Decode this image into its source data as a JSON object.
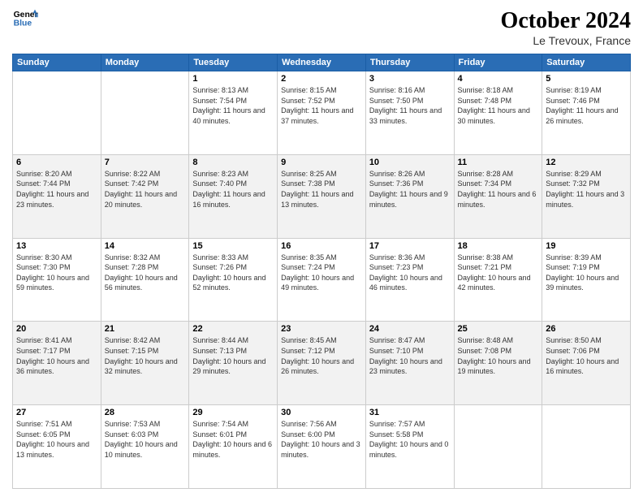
{
  "header": {
    "logo_line1": "General",
    "logo_line2": "Blue",
    "title": "October 2024",
    "subtitle": "Le Trevoux, France"
  },
  "columns": [
    "Sunday",
    "Monday",
    "Tuesday",
    "Wednesday",
    "Thursday",
    "Friday",
    "Saturday"
  ],
  "weeks": [
    [
      {
        "day": "",
        "sunrise": "",
        "sunset": "",
        "daylight": ""
      },
      {
        "day": "",
        "sunrise": "",
        "sunset": "",
        "daylight": ""
      },
      {
        "day": "1",
        "sunrise": "Sunrise: 8:13 AM",
        "sunset": "Sunset: 7:54 PM",
        "daylight": "Daylight: 11 hours and 40 minutes."
      },
      {
        "day": "2",
        "sunrise": "Sunrise: 8:15 AM",
        "sunset": "Sunset: 7:52 PM",
        "daylight": "Daylight: 11 hours and 37 minutes."
      },
      {
        "day": "3",
        "sunrise": "Sunrise: 8:16 AM",
        "sunset": "Sunset: 7:50 PM",
        "daylight": "Daylight: 11 hours and 33 minutes."
      },
      {
        "day": "4",
        "sunrise": "Sunrise: 8:18 AM",
        "sunset": "Sunset: 7:48 PM",
        "daylight": "Daylight: 11 hours and 30 minutes."
      },
      {
        "day": "5",
        "sunrise": "Sunrise: 8:19 AM",
        "sunset": "Sunset: 7:46 PM",
        "daylight": "Daylight: 11 hours and 26 minutes."
      }
    ],
    [
      {
        "day": "6",
        "sunrise": "Sunrise: 8:20 AM",
        "sunset": "Sunset: 7:44 PM",
        "daylight": "Daylight: 11 hours and 23 minutes."
      },
      {
        "day": "7",
        "sunrise": "Sunrise: 8:22 AM",
        "sunset": "Sunset: 7:42 PM",
        "daylight": "Daylight: 11 hours and 20 minutes."
      },
      {
        "day": "8",
        "sunrise": "Sunrise: 8:23 AM",
        "sunset": "Sunset: 7:40 PM",
        "daylight": "Daylight: 11 hours and 16 minutes."
      },
      {
        "day": "9",
        "sunrise": "Sunrise: 8:25 AM",
        "sunset": "Sunset: 7:38 PM",
        "daylight": "Daylight: 11 hours and 13 minutes."
      },
      {
        "day": "10",
        "sunrise": "Sunrise: 8:26 AM",
        "sunset": "Sunset: 7:36 PM",
        "daylight": "Daylight: 11 hours and 9 minutes."
      },
      {
        "day": "11",
        "sunrise": "Sunrise: 8:28 AM",
        "sunset": "Sunset: 7:34 PM",
        "daylight": "Daylight: 11 hours and 6 minutes."
      },
      {
        "day": "12",
        "sunrise": "Sunrise: 8:29 AM",
        "sunset": "Sunset: 7:32 PM",
        "daylight": "Daylight: 11 hours and 3 minutes."
      }
    ],
    [
      {
        "day": "13",
        "sunrise": "Sunrise: 8:30 AM",
        "sunset": "Sunset: 7:30 PM",
        "daylight": "Daylight: 10 hours and 59 minutes."
      },
      {
        "day": "14",
        "sunrise": "Sunrise: 8:32 AM",
        "sunset": "Sunset: 7:28 PM",
        "daylight": "Daylight: 10 hours and 56 minutes."
      },
      {
        "day": "15",
        "sunrise": "Sunrise: 8:33 AM",
        "sunset": "Sunset: 7:26 PM",
        "daylight": "Daylight: 10 hours and 52 minutes."
      },
      {
        "day": "16",
        "sunrise": "Sunrise: 8:35 AM",
        "sunset": "Sunset: 7:24 PM",
        "daylight": "Daylight: 10 hours and 49 minutes."
      },
      {
        "day": "17",
        "sunrise": "Sunrise: 8:36 AM",
        "sunset": "Sunset: 7:23 PM",
        "daylight": "Daylight: 10 hours and 46 minutes."
      },
      {
        "day": "18",
        "sunrise": "Sunrise: 8:38 AM",
        "sunset": "Sunset: 7:21 PM",
        "daylight": "Daylight: 10 hours and 42 minutes."
      },
      {
        "day": "19",
        "sunrise": "Sunrise: 8:39 AM",
        "sunset": "Sunset: 7:19 PM",
        "daylight": "Daylight: 10 hours and 39 minutes."
      }
    ],
    [
      {
        "day": "20",
        "sunrise": "Sunrise: 8:41 AM",
        "sunset": "Sunset: 7:17 PM",
        "daylight": "Daylight: 10 hours and 36 minutes."
      },
      {
        "day": "21",
        "sunrise": "Sunrise: 8:42 AM",
        "sunset": "Sunset: 7:15 PM",
        "daylight": "Daylight: 10 hours and 32 minutes."
      },
      {
        "day": "22",
        "sunrise": "Sunrise: 8:44 AM",
        "sunset": "Sunset: 7:13 PM",
        "daylight": "Daylight: 10 hours and 29 minutes."
      },
      {
        "day": "23",
        "sunrise": "Sunrise: 8:45 AM",
        "sunset": "Sunset: 7:12 PM",
        "daylight": "Daylight: 10 hours and 26 minutes."
      },
      {
        "day": "24",
        "sunrise": "Sunrise: 8:47 AM",
        "sunset": "Sunset: 7:10 PM",
        "daylight": "Daylight: 10 hours and 23 minutes."
      },
      {
        "day": "25",
        "sunrise": "Sunrise: 8:48 AM",
        "sunset": "Sunset: 7:08 PM",
        "daylight": "Daylight: 10 hours and 19 minutes."
      },
      {
        "day": "26",
        "sunrise": "Sunrise: 8:50 AM",
        "sunset": "Sunset: 7:06 PM",
        "daylight": "Daylight: 10 hours and 16 minutes."
      }
    ],
    [
      {
        "day": "27",
        "sunrise": "Sunrise: 7:51 AM",
        "sunset": "Sunset: 6:05 PM",
        "daylight": "Daylight: 10 hours and 13 minutes."
      },
      {
        "day": "28",
        "sunrise": "Sunrise: 7:53 AM",
        "sunset": "Sunset: 6:03 PM",
        "daylight": "Daylight: 10 hours and 10 minutes."
      },
      {
        "day": "29",
        "sunrise": "Sunrise: 7:54 AM",
        "sunset": "Sunset: 6:01 PM",
        "daylight": "Daylight: 10 hours and 6 minutes."
      },
      {
        "day": "30",
        "sunrise": "Sunrise: 7:56 AM",
        "sunset": "Sunset: 6:00 PM",
        "daylight": "Daylight: 10 hours and 3 minutes."
      },
      {
        "day": "31",
        "sunrise": "Sunrise: 7:57 AM",
        "sunset": "Sunset: 5:58 PM",
        "daylight": "Daylight: 10 hours and 0 minutes."
      },
      {
        "day": "",
        "sunrise": "",
        "sunset": "",
        "daylight": ""
      },
      {
        "day": "",
        "sunrise": "",
        "sunset": "",
        "daylight": ""
      }
    ]
  ]
}
